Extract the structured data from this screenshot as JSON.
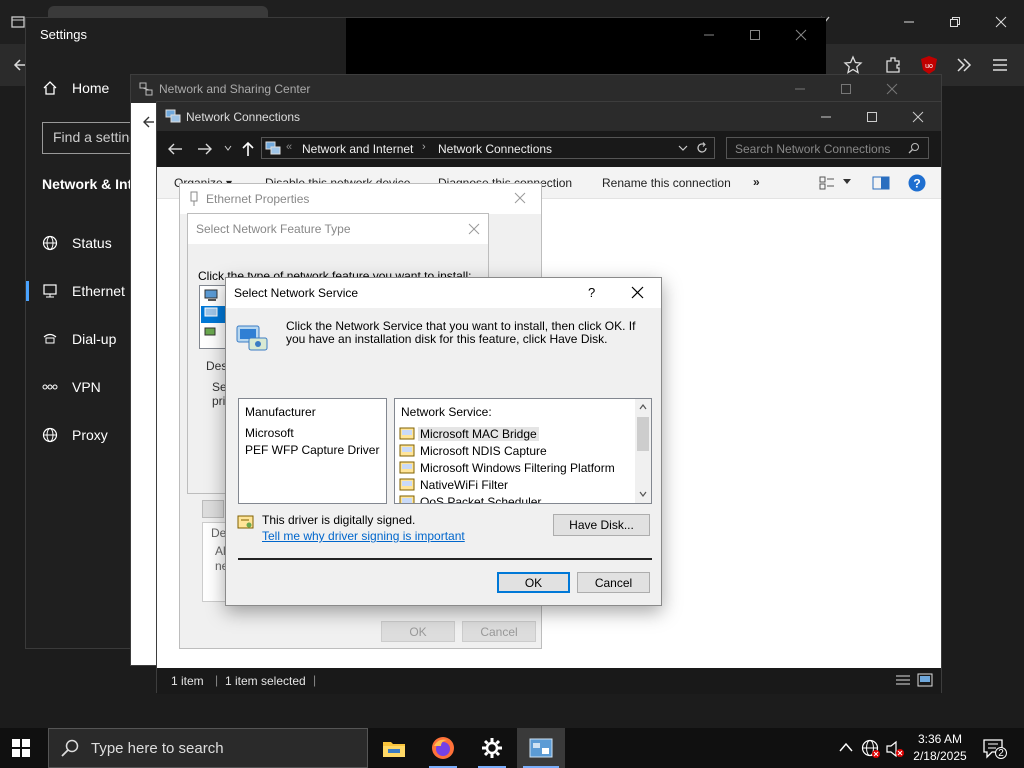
{
  "settings": {
    "title": "Settings",
    "home": "Home",
    "search_placeholder": "Find a setting",
    "section": "Network & Internet",
    "nav": [
      {
        "label": "Status",
        "icon": "globe-icon"
      },
      {
        "label": "Ethernet",
        "icon": "ethernet-icon"
      },
      {
        "label": "Dial-up",
        "icon": "dialup-icon"
      },
      {
        "label": "VPN",
        "icon": "vpn-icon"
      },
      {
        "label": "Proxy",
        "icon": "globe-icon"
      }
    ]
  },
  "nsc": {
    "title": "Network and Sharing Center"
  },
  "nc": {
    "title": "Network Connections",
    "breadcrumb": [
      "Network and Internet",
      "Network Connections"
    ],
    "search_placeholder": "Search Network Connections",
    "commands": [
      "Organize ▾",
      "Disable this network device",
      "Diagnose this connection",
      "Rename this connection",
      "»"
    ],
    "status": {
      "count": "1 item",
      "selected": "1 item selected"
    }
  },
  "ethprops": {
    "title": "Ethernet Properties",
    "desc_partial": [
      "Des",
      "All",
      "ne"
    ],
    "ok": "OK",
    "cancel": "Cancel"
  },
  "feattype": {
    "title": "Select Network Feature Type",
    "instruction": "Click the type of network feature you want to install:",
    "desc_partial": [
      "Des",
      "Se",
      "pri"
    ]
  },
  "netsvc": {
    "title": "Select Network Service",
    "help": "?",
    "instruction": "Click the Network Service that you want to install, then click OK. If you have an installation disk for this feature, click Have Disk.",
    "manufacturer_header": "Manufacturer",
    "manufacturers": [
      "Microsoft",
      "PEF WFP Capture Driver"
    ],
    "service_header": "Network Service:",
    "services": [
      "Microsoft MAC Bridge",
      "Microsoft NDIS Capture",
      "Microsoft Windows Filtering Platform",
      "NativeWiFi Filter",
      "QoS Packet Scheduler"
    ],
    "signed_text": "This driver is digitally signed.",
    "signing_link": "Tell me why driver signing is important",
    "have_disk": "Have Disk...",
    "ok": "OK",
    "cancel": "Cancel"
  },
  "taskbar": {
    "search_placeholder": "Type here to search",
    "time": "3:36 AM",
    "date": "2/18/2025",
    "notifications": "2"
  },
  "colors": {
    "accent": "#0078d7",
    "link": "#0066cc",
    "selection": "#cce8ff"
  }
}
